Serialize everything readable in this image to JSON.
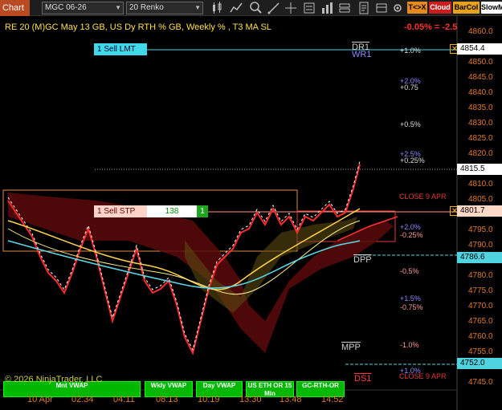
{
  "toolbar": {
    "tab_label": "Chart",
    "instrument": "MGC 06-26",
    "bar_type": "20 Renko",
    "badges": [
      {
        "label": "T<>X",
        "bg": "#e58a1e",
        "fg": "#000000"
      },
      {
        "label": "Cloud",
        "bg": "#c81e1e",
        "fg": "#ffffff"
      },
      {
        "label": "BarCol",
        "bg": "#e5a21e",
        "fg": "#000000"
      },
      {
        "label": "SlowM",
        "bg": "#ffffff",
        "fg": "#000000"
      }
    ]
  },
  "chart": {
    "title": "RE 20  (M)GC May 13 GB, US Dy RTH % GB, Weekly % , T3 MA SL",
    "change": "-0.05% = -2.5",
    "copyright": "© 2026 NinjaTrader, LLC",
    "ma_label": "T3 MA SL",
    "orders": [
      {
        "label": "1 Sell LMT",
        "price": "4854.4"
      },
      {
        "label": "1 Sell STP",
        "price": "4801.7",
        "qty": "138",
        "count": "1"
      }
    ],
    "levels": {
      "dr1": "DR1",
      "wr1": "WR1",
      "dpp": "DPP",
      "mpp": "MPP",
      "ds1": "DS1",
      "close_apr9_a": "CLOSE 9 APR",
      "close_apr9_b": "CLOSE 9 APR"
    },
    "pct_labels": [
      {
        "text": "+1.0%",
        "color": "#dddddd"
      },
      {
        "text": "+2.0%",
        "color": "#8a8aff"
      },
      {
        "text": "+0.75",
        "color": "#dddddd"
      },
      {
        "text": "+0.5%",
        "color": "#dddddd"
      },
      {
        "text": "+2.5%",
        "color": "#8a8aff"
      },
      {
        "text": "+0.25%",
        "color": "#dddddd"
      },
      {
        "text": "+2.0%",
        "color": "#8a8aff"
      },
      {
        "text": "-0.25%",
        "color": "#ff9a9a"
      },
      {
        "text": "-0.5%",
        "color": "#ff9a9a"
      },
      {
        "text": "+1.5%",
        "color": "#8a8aff"
      },
      {
        "text": "-0.75%",
        "color": "#ff9a9a"
      },
      {
        "text": "-1.0%",
        "color": "#ff9a9a"
      },
      {
        "text": "+1.0%",
        "color": "#8a8aff"
      }
    ],
    "y_axis": [
      "4860.0",
      "4850.0",
      "4845.0",
      "4840.0",
      "4835.0",
      "4830.0",
      "4825.0",
      "4820.0",
      "4810.0",
      "4805.0",
      "4795.0",
      "4790.0",
      "4785.0",
      "4780.0",
      "4775.0",
      "4770.0",
      "4765.0",
      "4760.0",
      "4755.0",
      "4745.0"
    ],
    "price_boxes": [
      {
        "value": "4854.4",
        "bg": "#ffffff"
      },
      {
        "value": "4815.5",
        "bg": "#ffffff"
      },
      {
        "value": "4801.7",
        "bg": "#ffd9c8"
      },
      {
        "value": "4786.6",
        "bg": "#4fd3e0"
      },
      {
        "value": "4752.0",
        "bg": "#4fd3e0"
      }
    ],
    "x_axis": [
      "10 Apr",
      "02:34",
      "04:11",
      "08:13",
      "10:19",
      "13:30",
      "13:48",
      "14:52"
    ],
    "vwap_buttons": [
      {
        "label": "Mnt VWAP"
      },
      {
        "label": "Wkly VWAP"
      },
      {
        "label": "Day VWAP"
      },
      {
        "label": "US ETH OR 15 Min"
      },
      {
        "label": "GC-RTH-OR"
      }
    ]
  }
}
